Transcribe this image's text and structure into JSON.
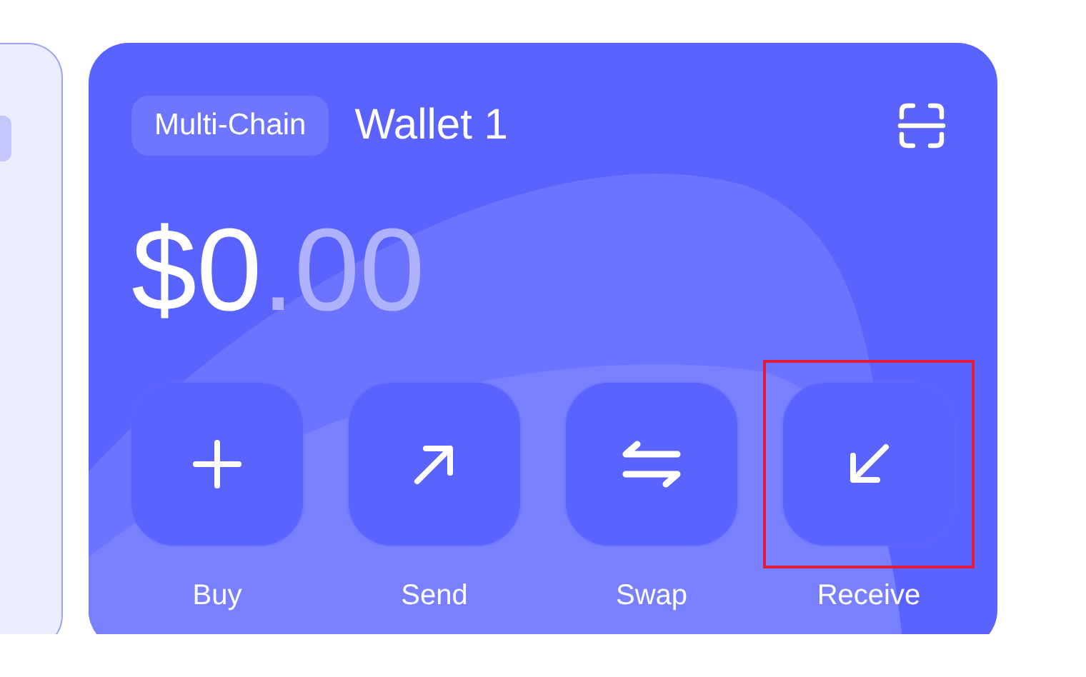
{
  "wallet": {
    "chain_badge": "Multi-Chain",
    "name": "Wallet 1",
    "balance_whole": "$0",
    "balance_fraction": ".00"
  },
  "actions": [
    {
      "kind": "buy",
      "label": "Buy",
      "highlighted": false
    },
    {
      "kind": "send",
      "label": "Send",
      "highlighted": false
    },
    {
      "kind": "swap",
      "label": "Swap",
      "highlighted": false
    },
    {
      "kind": "receive",
      "label": "Receive",
      "highlighted": true
    }
  ]
}
